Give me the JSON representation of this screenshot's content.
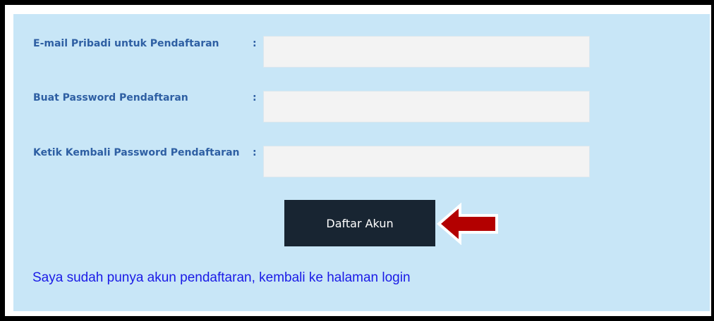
{
  "form": {
    "email": {
      "label": "E-mail Pribadi untuk Pendaftaran",
      "separator": ":",
      "value": ""
    },
    "password": {
      "label": "Buat Password Pendaftaran",
      "separator": ":",
      "value": ""
    },
    "password_confirm": {
      "label": "Ketik Kembali Password Pendaftaran",
      "separator": ":",
      "value": ""
    }
  },
  "submit_button": {
    "label": "Daftar Akun"
  },
  "login_link": {
    "text": "Saya sudah punya akun pendaftaran, kembali ke halaman login"
  },
  "arrow_icon": {
    "name": "left-arrow-icon",
    "color": "#b30000"
  },
  "colors": {
    "panel": "#c8e6f7",
    "label": "#2e5fa3",
    "button": "#182532",
    "link": "#1a1ae6",
    "field": "#f3f3f3"
  }
}
